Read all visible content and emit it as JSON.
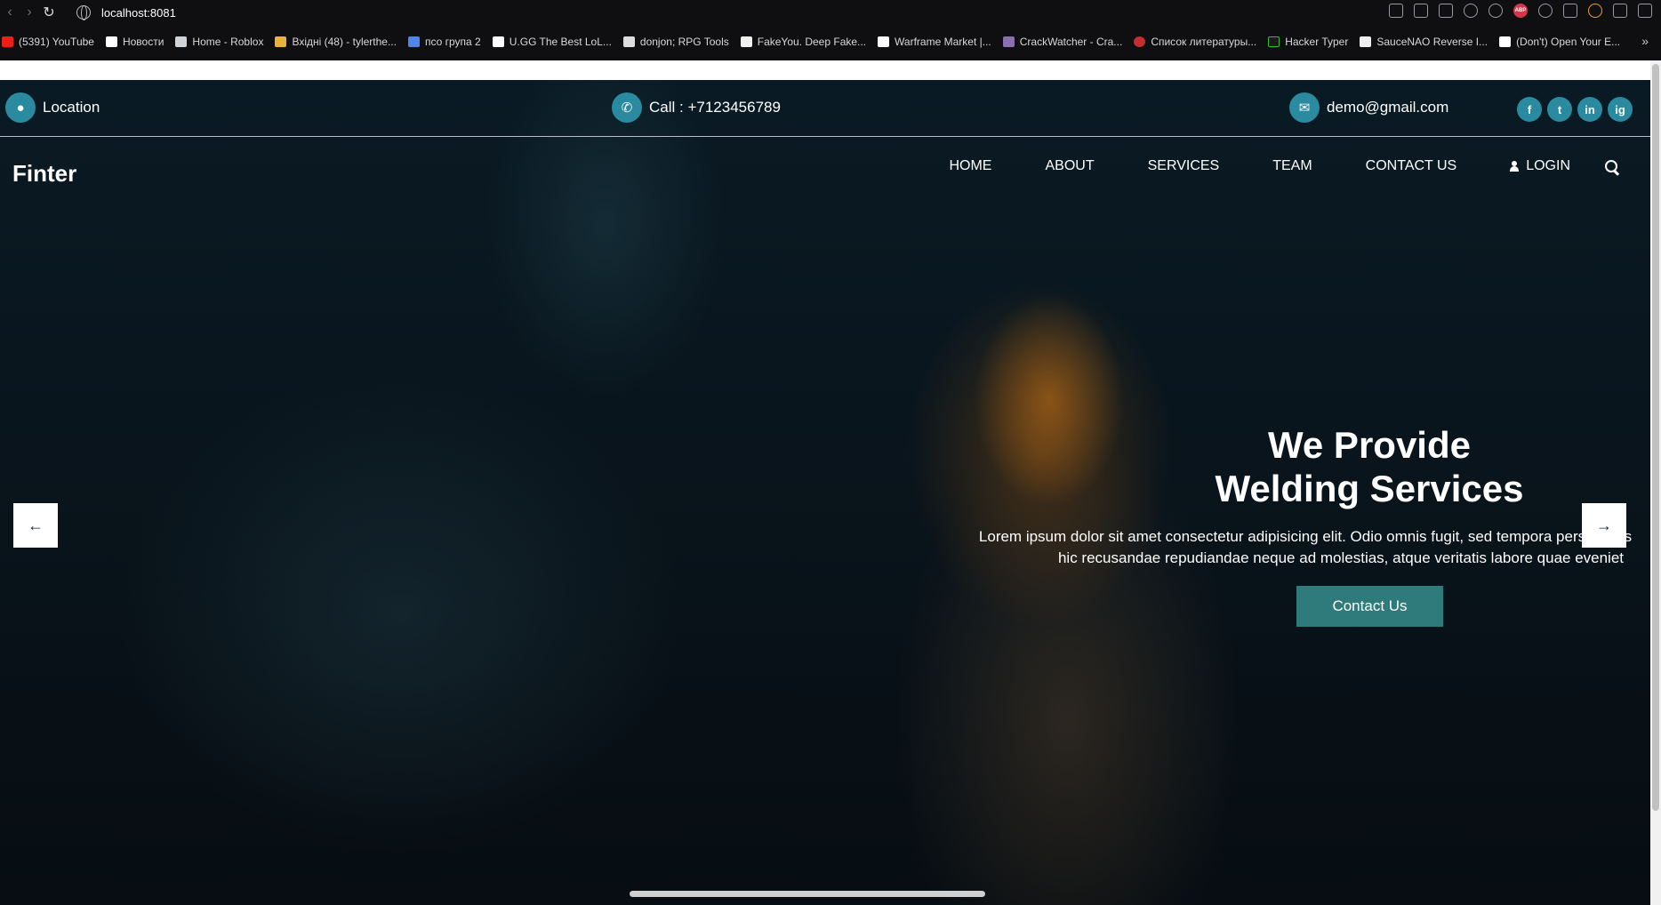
{
  "browser": {
    "url": "localhost:8081",
    "bookmarks": [
      {
        "label": "(5391) YouTube"
      },
      {
        "label": "Новости"
      },
      {
        "label": "Home - Roblox"
      },
      {
        "label": "Вхідні (48) - tylerthe..."
      },
      {
        "label": "псо група 2"
      },
      {
        "label": "U.GG The Best LoL..."
      },
      {
        "label": "donjon; RPG Tools"
      },
      {
        "label": "FakeYou. Deep Fake..."
      },
      {
        "label": "Warframe Market |..."
      },
      {
        "label": "CrackWatcher - Cra..."
      },
      {
        "label": "Список литературы..."
      },
      {
        "label": "Hacker Typer"
      },
      {
        "label": "SauceNAO Reverse I..."
      },
      {
        "label": "(Don't) Open Your E..."
      }
    ],
    "more": "»"
  },
  "info_bar": {
    "location": "Location",
    "call": "Call : +7123456789",
    "email": "demo@gmail.com",
    "socials": [
      "f",
      "t",
      "in",
      "ig"
    ]
  },
  "header": {
    "brand": "Finter",
    "nav": [
      "HOME",
      "ABOUT",
      "SERVICES",
      "TEAM",
      "CONTACT US"
    ],
    "login": "LOGIN"
  },
  "slider": {
    "title_line1": "We Provide",
    "title_line2": "Welding Services",
    "text_line1": "Lorem ipsum dolor sit amet consectetur adipisicing elit. Odio omnis fugit, sed tempora perspiciatis",
    "text_line2": "hic recusandae repudiandae neque ad molestias, atque veritatis labore quae eveniet",
    "cta": "Contact Us",
    "prev_arrow": "←",
    "next_arrow": "→"
  },
  "colors": {
    "accent": "#2a8aa0",
    "button": "#2f7b7c",
    "hero_bg": "#0a1a24"
  }
}
